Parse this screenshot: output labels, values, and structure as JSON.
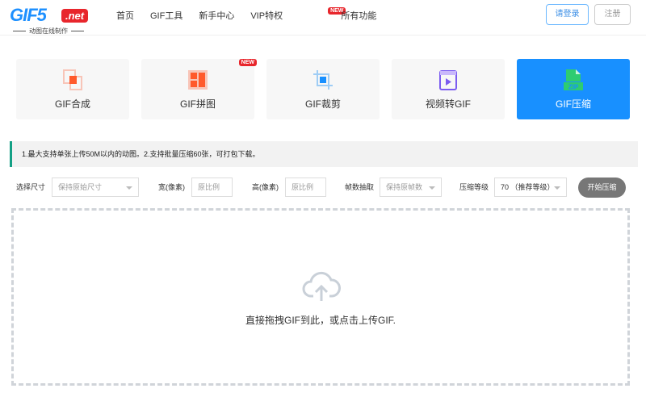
{
  "header": {
    "logo_text": "GIF5",
    "logo_net": ".net",
    "logo_sub": "动图在线制作",
    "nav": [
      {
        "label": "首页"
      },
      {
        "label": "GIF工具"
      },
      {
        "label": "新手中心"
      },
      {
        "label": "VIP特权",
        "badge": "NEW"
      },
      {
        "label": "所有功能"
      }
    ],
    "login": "请登录",
    "register": "注册"
  },
  "tools": [
    {
      "label": "GIF合成"
    },
    {
      "label": "GIF拼图",
      "badge": "NEW"
    },
    {
      "label": "GIF裁剪"
    },
    {
      "label": "视频转GIF"
    },
    {
      "label": "GIF压缩",
      "active": true
    }
  ],
  "notice": "1.最大支持单张上传50M以内的动图。2.支持批量压缩60张，可打包下载。",
  "controls": {
    "size_label": "选择尺寸",
    "size_value": "保持原始尺寸",
    "width_label": "宽(像素)",
    "width_placeholder": "原比例",
    "height_label": "高(像素)",
    "height_placeholder": "原比例",
    "frames_label": "帧数抽取",
    "frames_value": "保持原帧数",
    "level_label": "压缩等级",
    "level_value": "70 （推荐等级）",
    "start": "开始压缩"
  },
  "drop": {
    "text": "直接拖拽GIF到此，或点击上传GIF."
  },
  "colors": {
    "accent": "#1890ff",
    "notice_border": "#14a085"
  }
}
